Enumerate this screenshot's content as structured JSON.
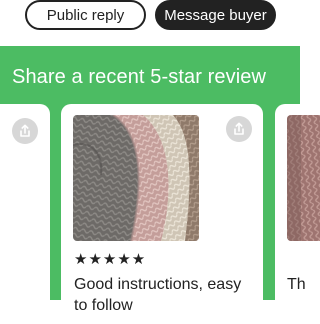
{
  "actions": {
    "public_reply_label": "Public reply",
    "message_buyer_label": "Message buyer"
  },
  "share_section": {
    "title": "Share a recent 5-star review",
    "cards": [
      {
        "rating": "★★★★★",
        "review_text": "Good instructions, easy to follow",
        "icon": "share-icon"
      },
      {
        "review_text_fragment": "Th",
        "icon": "share-icon"
      }
    ]
  },
  "colors": {
    "accent_green": "#4cbc63",
    "dark": "#222222",
    "share_button_bg": "#d7d7d7"
  }
}
